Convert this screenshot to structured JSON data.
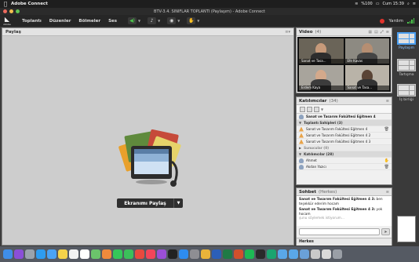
{
  "menubar": {
    "app_name": "Adobe Connect",
    "battery": "%100",
    "clock": "Cum 15:39"
  },
  "window": {
    "title": "BTV-3.4. SINIFLAR TOPLANTI (Paylaşım) - Adobe Connect"
  },
  "app_menu": {
    "logo_label": "Adobe",
    "items": [
      "Toplantı",
      "Düzenler",
      "Bölmeler",
      "Ses"
    ],
    "help_label": "Yardım"
  },
  "share_pod": {
    "title": "Paylaş",
    "share_button_label": "Ekranımı Paylaş"
  },
  "video_pod": {
    "title": "Video",
    "count": "(4)",
    "tiles": [
      {
        "name": "Sanat ve Tasa..."
      },
      {
        "name": "Efe Kavas"
      },
      {
        "name": "Erdem Kaya"
      },
      {
        "name": "Sanat ve Tasa..."
      }
    ]
  },
  "attendees_pod": {
    "title": "Katılımcılar",
    "count": "(34)",
    "presenter_row": "Sanat ve Tasarım Fakültesi Eğitmen 4",
    "sections": [
      {
        "label": "Toplantı Sahipleri (3)",
        "rows": [
          "Sanat ve Tasarım Fakültesi Eğitmen 4",
          "Sanat ve Tasarım Fakültesi Eğitmen 4 2",
          "Sanat ve Tasarım Fakültesi Eğitmen 4 3"
        ]
      },
      {
        "label": "Sunucular (0)",
        "rows": []
      },
      {
        "label": "Katılımcılar (28)",
        "rows": [
          "Ahmet",
          "Akdan Yazıcı"
        ]
      }
    ]
  },
  "chat_pod": {
    "title": "Sohbet",
    "subtitle": "(Herkes)",
    "messages": [
      {
        "who": "Sanat ve Tasarım Fakültesi Eğitmen 4 3:",
        "text": "ben teşekkür ederim hocam"
      },
      {
        "who": "Sanat ve Tasarım Fakültesi Eğitmen 4 3:",
        "text": "yok hocam"
      },
      {
        "who": "",
        "text": "şunu söylemek istiyorum..."
      }
    ],
    "tab_label": "Herkes"
  },
  "layouts": {
    "items": [
      "Paylaşım",
      "Tartışma",
      "İş birliği"
    ]
  },
  "colors": {
    "accent": "#4a9ef0",
    "record": "#e0332c",
    "mic_level": "#4cc94c"
  }
}
